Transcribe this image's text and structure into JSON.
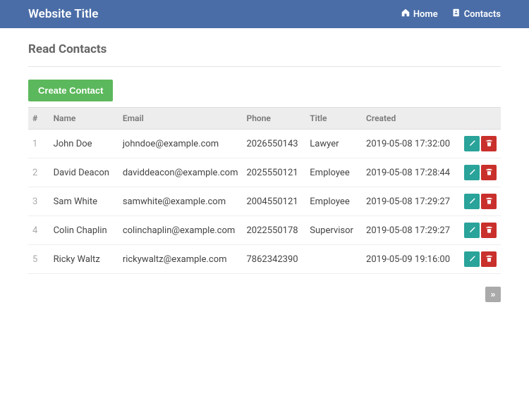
{
  "navbar": {
    "title": "Website Title",
    "links": {
      "home": "Home",
      "contacts": "Contacts"
    }
  },
  "page": {
    "title": "Read Contacts",
    "create_button": "Create Contact"
  },
  "table": {
    "headers": {
      "idx": "#",
      "name": "Name",
      "email": "Email",
      "phone": "Phone",
      "title": "Title",
      "created": "Created"
    },
    "rows": [
      {
        "idx": "1",
        "name": "John Doe",
        "email": "johndoe@example.com",
        "phone": "2026550143",
        "title": "Lawyer",
        "created": "2019-05-08 17:32:00"
      },
      {
        "idx": "2",
        "name": "David Deacon",
        "email": "daviddeacon@example.com",
        "phone": "2025550121",
        "title": "Employee",
        "created": "2019-05-08 17:28:44"
      },
      {
        "idx": "3",
        "name": "Sam White",
        "email": "samwhite@example.com",
        "phone": "2004550121",
        "title": "Employee",
        "created": "2019-05-08 17:29:27"
      },
      {
        "idx": "4",
        "name": "Colin Chaplin",
        "email": "colinchaplin@example.com",
        "phone": "2022550178",
        "title": "Supervisor",
        "created": "2019-05-08 17:29:27"
      },
      {
        "idx": "5",
        "name": "Ricky Waltz",
        "email": "rickywaltz@example.com",
        "phone": "7862342390",
        "title": "",
        "created": "2019-05-09 19:16:00"
      }
    ]
  },
  "pagination": {
    "next": "»"
  },
  "colors": {
    "navbar": "#4a6da7",
    "create": "#5cb85c",
    "edit": "#2aa39a",
    "delete": "#c9302c"
  }
}
